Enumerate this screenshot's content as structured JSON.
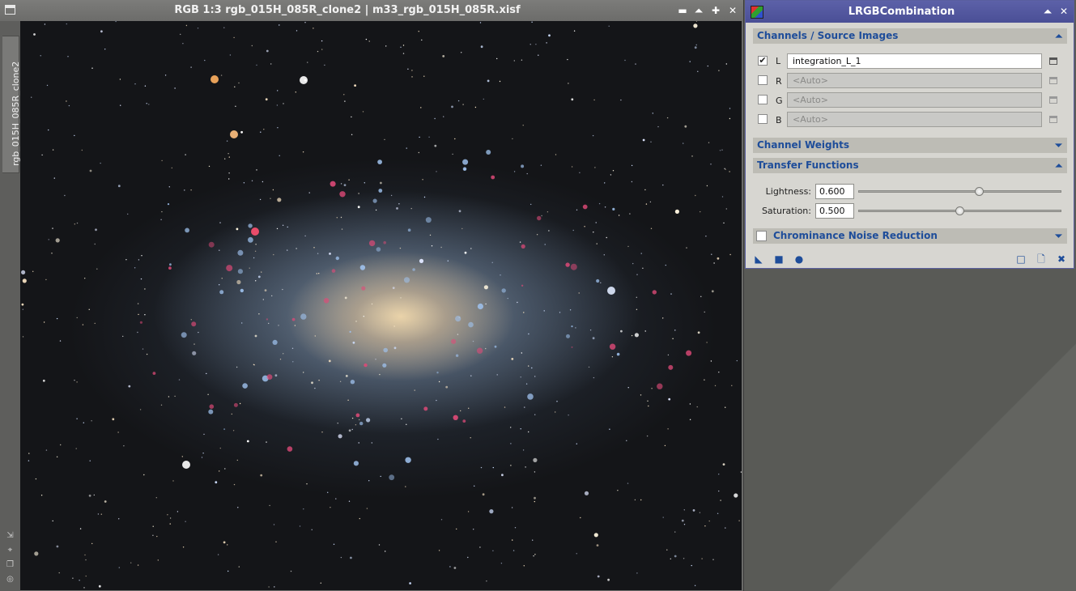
{
  "image_window": {
    "title": "RGB 1:3 rgb_015H_085R_clone2 | m33_rgb_015H_085R.xisf",
    "side_tab": "rgb_015H_085R_clone2",
    "buttons": {
      "shade": "▬",
      "minimize": "⏶",
      "maximize": "✚",
      "close": "✕"
    }
  },
  "panel": {
    "title": "LRGBCombination",
    "buttons": {
      "shade": "⏶",
      "close": "✕"
    },
    "sections": {
      "channels": {
        "label": "Channels / Source Images",
        "arrow": "⏶"
      },
      "weights": {
        "label": "Channel Weights",
        "arrow": "⏷"
      },
      "transfer": {
        "label": "Transfer Functions",
        "arrow": "⏶"
      },
      "chroma": {
        "label": "Chrominance Noise Reduction",
        "arrow": "⏷"
      }
    },
    "channels": [
      {
        "letter": "L",
        "checked": "✔",
        "value": "integration_L_1"
      },
      {
        "letter": "R",
        "checked": "",
        "value": "<Auto>"
      },
      {
        "letter": "G",
        "checked": "",
        "value": "<Auto>"
      },
      {
        "letter": "B",
        "checked": "",
        "value": "<Auto>"
      }
    ],
    "transfer": {
      "lightness_label": "Lightness:",
      "lightness_value": "0.600",
      "lightness_fraction": 0.6,
      "saturation_label": "Saturation:",
      "saturation_value": "0.500",
      "saturation_fraction": 0.5
    },
    "bottom_icons": {
      "new_instance": "◣",
      "apply_global": "■",
      "execute": "●",
      "browse_doc": "□",
      "edit_doc": "🗋",
      "reset": "✖"
    }
  }
}
